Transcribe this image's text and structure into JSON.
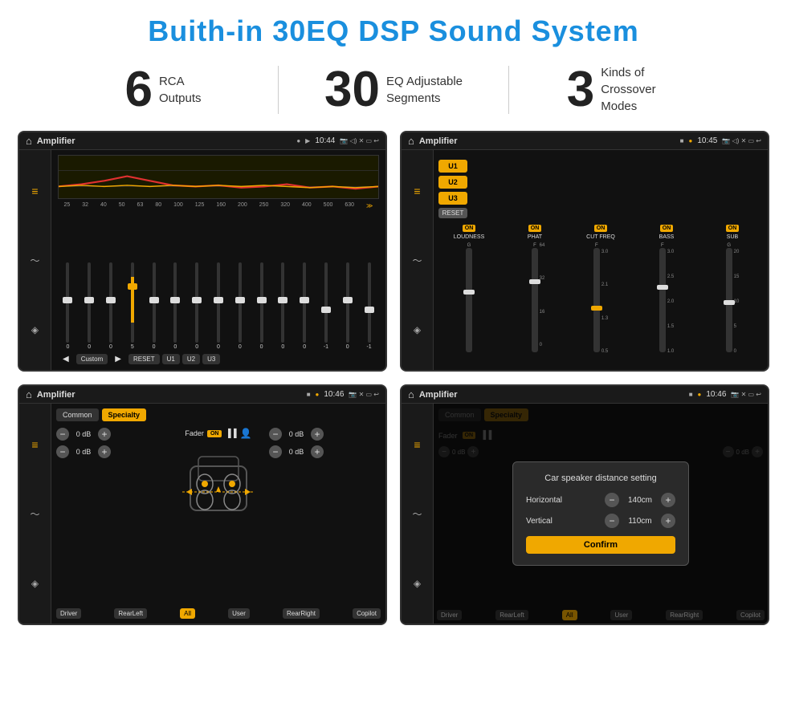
{
  "title": "Buith-in 30EQ DSP Sound System",
  "stats": [
    {
      "number": "6",
      "label": "RCA\nOutputs"
    },
    {
      "number": "30",
      "label": "EQ Adjustable\nSegments"
    },
    {
      "number": "3",
      "label": "Kinds of\nCrossover Modes"
    }
  ],
  "screens": [
    {
      "id": "screen-eq",
      "topbar": {
        "title": "Amplifier",
        "time": "10:44"
      },
      "type": "eq",
      "eq_labels": [
        "25",
        "32",
        "40",
        "50",
        "63",
        "80",
        "100",
        "125",
        "160",
        "200",
        "250",
        "320",
        "400",
        "500",
        "630"
      ],
      "eq_values": [
        "0",
        "0",
        "0",
        "5",
        "0",
        "0",
        "0",
        "0",
        "0",
        "0",
        "0",
        "0",
        "-1",
        "0",
        "-1"
      ],
      "eq_positions": [
        50,
        50,
        50,
        30,
        50,
        50,
        50,
        50,
        50,
        50,
        50,
        50,
        65,
        50,
        65
      ],
      "buttons": [
        "Custom",
        "RESET",
        "U1",
        "U2",
        "U3"
      ]
    },
    {
      "id": "screen-amp",
      "topbar": {
        "title": "Amplifier",
        "time": "10:45"
      },
      "type": "amp",
      "presets": [
        "U1",
        "U2",
        "U3"
      ],
      "channels": [
        {
          "name": "LOUDNESS",
          "on": true
        },
        {
          "name": "PHAT",
          "on": true
        },
        {
          "name": "CUT FREQ",
          "on": true
        },
        {
          "name": "BASS",
          "on": true
        },
        {
          "name": "SUB",
          "on": true
        }
      ],
      "reset_btn": "RESET"
    },
    {
      "id": "screen-fader",
      "topbar": {
        "title": "Amplifier",
        "time": "10:46"
      },
      "type": "fader",
      "tabs": [
        "Common",
        "Specialty"
      ],
      "active_tab": "Specialty",
      "fader_label": "Fader",
      "fader_on": "ON",
      "left_values": [
        "0 dB",
        "0 dB"
      ],
      "right_values": [
        "0 dB",
        "0 dB"
      ],
      "bottom_buttons": [
        "Driver",
        "RearLeft",
        "All",
        "User",
        "RearRight",
        "Copilot"
      ]
    },
    {
      "id": "screen-distance",
      "topbar": {
        "title": "Amplifier",
        "time": "10:46"
      },
      "type": "distance-dialog",
      "tabs": [
        "Common",
        "Specialty"
      ],
      "dialog": {
        "title": "Car speaker distance setting",
        "horizontal_label": "Horizontal",
        "horizontal_value": "140cm",
        "vertical_label": "Vertical",
        "vertical_value": "110cm",
        "confirm_label": "Confirm"
      },
      "bottom_buttons": [
        "Driver",
        "RearLeft",
        "All",
        "User",
        "RearRight",
        "Copilot"
      ]
    }
  ],
  "icons": {
    "home": "⌂",
    "music": "♪",
    "volume": "◁)",
    "star": "★",
    "back": "↩",
    "settings": "⚙",
    "location": "📍",
    "camera": "📷",
    "eq_icon": "≡",
    "wave_icon": "〜",
    "speaker_icon": "◈"
  }
}
